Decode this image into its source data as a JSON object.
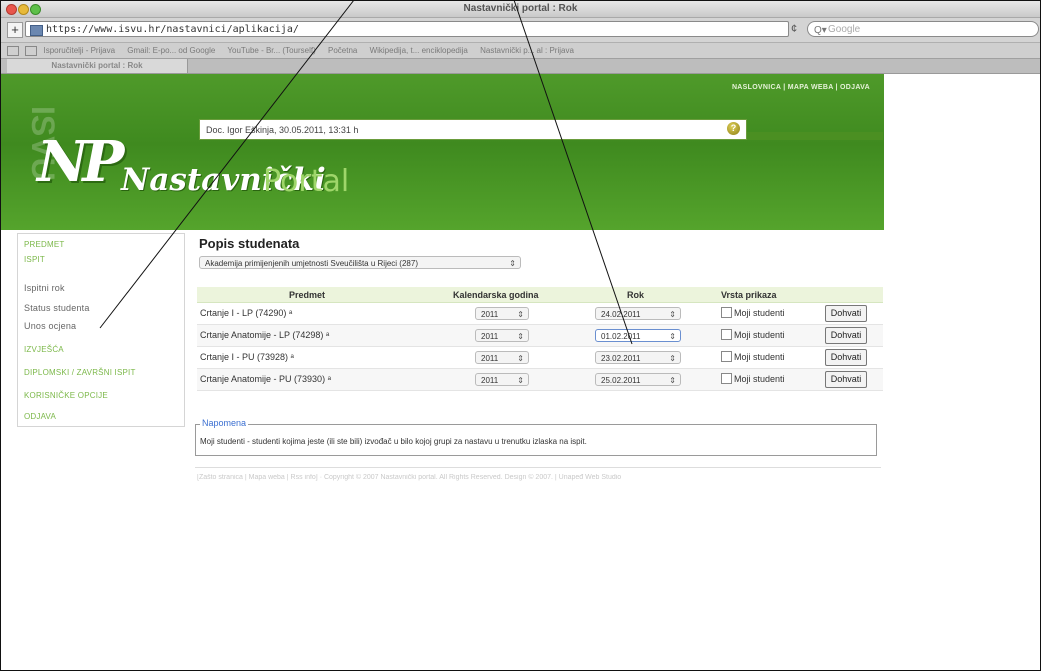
{
  "browser": {
    "window_title": "Nastavnički portal : Rok",
    "url": "https://www.isvu.hr/nastavnici/aplikacija/",
    "search_placeholder": "Google",
    "bookmarks": [
      "Isporučitelji - Prijava",
      "Gmail: E-po... od Google",
      "YouTube - Br... (Tourself)",
      "Početna",
      "Wikipedija, t... enciklopedija",
      "Nastavnički p... al : Prijava"
    ],
    "tab_title": "Nastavnički portal : Rok"
  },
  "header": {
    "top_nav": "NASLOVNICA  |  MAPA WEBA  |  ODJAVA",
    "logo_mark": "NP",
    "logo_part1": "Nastavnički",
    "logo_part2": "Portal",
    "logo_ghost": "ISVU",
    "user_info": "Doc. Igor Eškinja, 30.05.2011, 13:31 h",
    "help_icon": "help-icon"
  },
  "sidebar": {
    "items": [
      {
        "label": "PREDMET",
        "type": "main"
      },
      {
        "label": "ISPIT",
        "type": "main"
      },
      {
        "label": "Ispitni rok",
        "type": "sub"
      },
      {
        "label": "Status studenta",
        "type": "sub"
      },
      {
        "label": "Unos ocjena",
        "type": "sub"
      },
      {
        "label": "IZVJEŠĆA",
        "type": "main"
      },
      {
        "label": "DIPLOMSKI / ZAVRŠNI ISPIT",
        "type": "main"
      },
      {
        "label": "KORISNIČKE OPCIJE",
        "type": "main"
      },
      {
        "label": "ODJAVA",
        "type": "main"
      }
    ]
  },
  "main": {
    "title": "Popis studenata",
    "institution_select": "Akademija primijenjenih umjetnosti Sveučilišta u Rijeci (287)",
    "columns": [
      "Predmet",
      "Kalendarska godina",
      "Rok",
      "Vrsta prikaza"
    ],
    "rows": [
      {
        "subject": "Crtanje I - LP (74290)",
        "year": "2011",
        "date": "24.02.2011",
        "view_label": "Moji studenti",
        "button": "Dohvati"
      },
      {
        "subject": "Crtanje Anatomije - LP (74298)",
        "year": "2011",
        "date": "01.02.2011",
        "view_label": "Moji studenti",
        "button": "Dohvati"
      },
      {
        "subject": "Crtanje I - PU (73928)",
        "year": "2011",
        "date": "23.02.2011",
        "view_label": "Moji studenti",
        "button": "Dohvati"
      },
      {
        "subject": "Crtanje Anatomije - PU (73930)",
        "year": "2011",
        "date": "25.02.2011",
        "view_label": "Moji studenti",
        "button": "Dohvati"
      }
    ],
    "note_legend": "Napomena",
    "note_text": "Moji studenti - studenti kojima jeste (ili ste bili) izvođač u bilo kojoj grupi za nastavu u trenutku izlaska na ispit.",
    "footer": "[Zašto stranica | Mapa weba | Rss info]   ·   Copyright © 2007 Nastavnički portal. All Rights Reserved. Design © 2007. | Unapeđ Web Studio"
  },
  "colors": {
    "header_green": "#4f9a2a",
    "sidebar_link": "#7cb84a",
    "note_legend": "#3b6fd1"
  }
}
